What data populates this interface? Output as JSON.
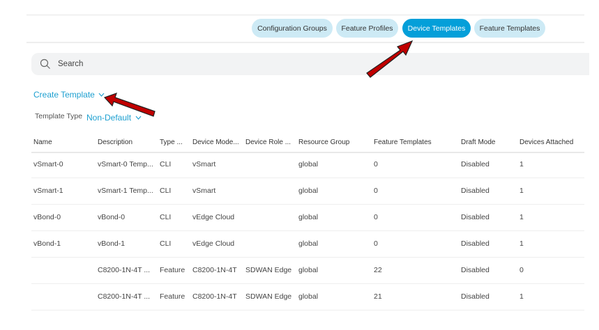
{
  "tabs": [
    {
      "label": "Configuration Groups",
      "active": false
    },
    {
      "label": "Feature Profiles",
      "active": false
    },
    {
      "label": "Device Templates",
      "active": true
    },
    {
      "label": "Feature Templates",
      "active": false
    }
  ],
  "search": {
    "placeholder": "Search",
    "icon": "search-icon"
  },
  "create_template": {
    "label": "Create Template",
    "icon": "chevron-down-icon"
  },
  "template_type": {
    "label": "Template Type",
    "value": "Non-Default"
  },
  "table": {
    "columns": [
      "Name",
      "Description",
      "Type ...",
      "Device Mode...",
      "Device Role ...",
      "Resource Group",
      "Feature Templates",
      "Draft Mode",
      "Devices Attached"
    ],
    "rows": [
      [
        "vSmart-0",
        "vSmart-0 Temp...",
        "CLI",
        "vSmart",
        "",
        "global",
        "0",
        "Disabled",
        "1"
      ],
      [
        "vSmart-1",
        "vSmart-1 Temp...",
        "CLI",
        "vSmart",
        "",
        "global",
        "0",
        "Disabled",
        "1"
      ],
      [
        "vBond-0",
        "vBond-0",
        "CLI",
        "vEdge Cloud",
        "",
        "global",
        "0",
        "Disabled",
        "1"
      ],
      [
        "vBond-1",
        "vBond-1",
        "CLI",
        "vEdge Cloud",
        "",
        "global",
        "0",
        "Disabled",
        "1"
      ],
      [
        "",
        "C8200-1N-4T ...",
        "Feature",
        "C8200-1N-4T",
        "SDWAN Edge",
        "global",
        "22",
        "Disabled",
        "0"
      ],
      [
        "",
        "C8200-1N-4T ...",
        "Feature",
        "C8200-1N-4T",
        "SDWAN Edge",
        "global",
        "21",
        "Disabled",
        "1"
      ]
    ]
  },
  "colors": {
    "accent": "#049fd9",
    "tab_inactive": "#cdeaf5",
    "link": "#1c9fd0",
    "annotation_arrow": "#c00000"
  }
}
